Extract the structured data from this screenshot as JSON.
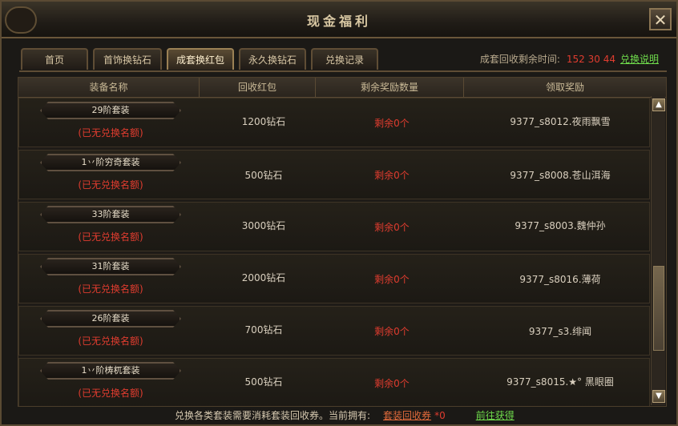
{
  "window": {
    "title": "现金福利",
    "close_label": "✕"
  },
  "tabs": [
    {
      "label": "首页",
      "active": false
    },
    {
      "label": "首饰换钻石",
      "active": false
    },
    {
      "label": "成套换红包",
      "active": true
    },
    {
      "label": "永久换钻石",
      "active": false
    },
    {
      "label": "兑换记录",
      "active": false
    }
  ],
  "timer": {
    "label": "成套回收剩余时间:",
    "value": "152 30 44",
    "help_link": "兑换说明"
  },
  "table": {
    "headers": [
      "装备名称",
      "回收红包",
      "剩余奖励数量",
      "领取奖励"
    ],
    "rows": [
      {
        "name": "29阶套装",
        "status": "(已无兑换名额)",
        "price": "1200钻石",
        "remain": "剩余0个",
        "reward": "9377_s8012.夜雨飘雪"
      },
      {
        "name": "1丷阶穷奇套装",
        "status": "(已无兑换名额)",
        "price": "500钻石",
        "remain": "剩余0个",
        "reward": "9377_s8008.苍山洱海"
      },
      {
        "name": "33阶套装",
        "status": "(已无兑换名额)",
        "price": "3000钻石",
        "remain": "剩余0个",
        "reward": "9377_s8003.魏仲孙"
      },
      {
        "name": "31阶套装",
        "status": "(已无兑换名额)",
        "price": "2000钻石",
        "remain": "剩余0个",
        "reward": "9377_s8016.薄荷"
      },
      {
        "name": "26阶套装",
        "status": "(已无兑换名额)",
        "price": "700钻石",
        "remain": "剩余0个",
        "reward": "9377_s3.绯闻"
      },
      {
        "name": "1丷阶梼杌套装",
        "status": "(已无兑换名额)",
        "price": "500钻石",
        "remain": "剩余0个",
        "reward": "9377_s8015.★° 黑眼圈"
      }
    ]
  },
  "footer": {
    "text": "兑换各类套装需要消耗套装回收券。当前拥有:",
    "coupon_label": "套装回收券",
    "coupon_count": "*0",
    "go_link": "前往获得"
  }
}
